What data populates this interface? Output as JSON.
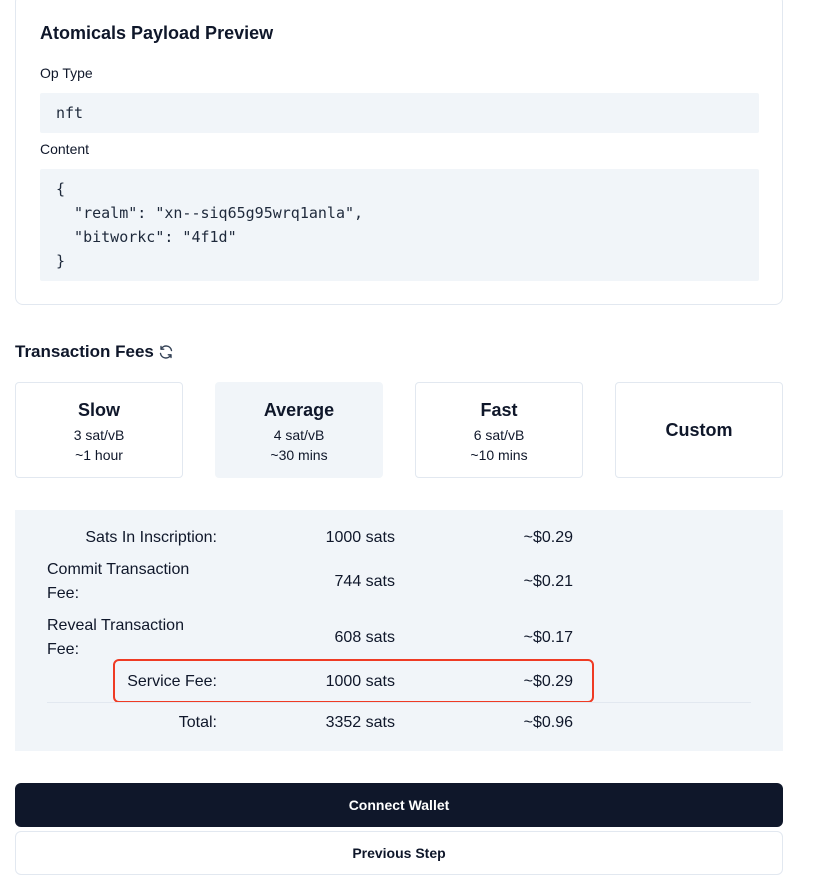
{
  "preview": {
    "title": "Atomicals Payload Preview",
    "op_type_label": "Op Type",
    "op_type_value": "nft",
    "content_label": "Content",
    "content_lines": [
      "{",
      "  \"realm\": \"xn--siq65g95wrq1anla\",",
      "  \"bitworkc\": \"4f1d\"",
      "}"
    ]
  },
  "fees": {
    "heading": "Transaction Fees",
    "refresh_icon": "refresh-icon",
    "options": [
      {
        "name": "Slow",
        "rate": "3 sat/vB",
        "time": "~1 hour",
        "selected": false
      },
      {
        "name": "Average",
        "rate": "4 sat/vB",
        "time": "~30 mins",
        "selected": true
      },
      {
        "name": "Fast",
        "rate": "6 sat/vB",
        "time": "~10 mins",
        "selected": false
      },
      {
        "name": "Custom",
        "rate": "",
        "time": "",
        "selected": false
      }
    ]
  },
  "summary": {
    "rows": [
      {
        "label": "Sats In Inscription:",
        "sats": "1000 sats",
        "usd": "~$0.29"
      },
      {
        "label": "Commit Transaction Fee:",
        "sats": "744 sats",
        "usd": "~$0.21"
      },
      {
        "label": "Reveal Transaction Fee:",
        "sats": "608 sats",
        "usd": "~$0.17"
      },
      {
        "label": "Service Fee:",
        "sats": "1000 sats",
        "usd": "~$0.29"
      }
    ],
    "total": {
      "label": "Total:",
      "sats": "3352 sats",
      "usd": "~$0.96"
    },
    "highlight_color": "#ef3b24"
  },
  "actions": {
    "connect_wallet": "Connect Wallet",
    "previous_step": "Previous Step"
  },
  "colors": {
    "primary_button": "#0f172a",
    "panel_bg": "#f1f5f9",
    "border": "#e2e8f0"
  }
}
